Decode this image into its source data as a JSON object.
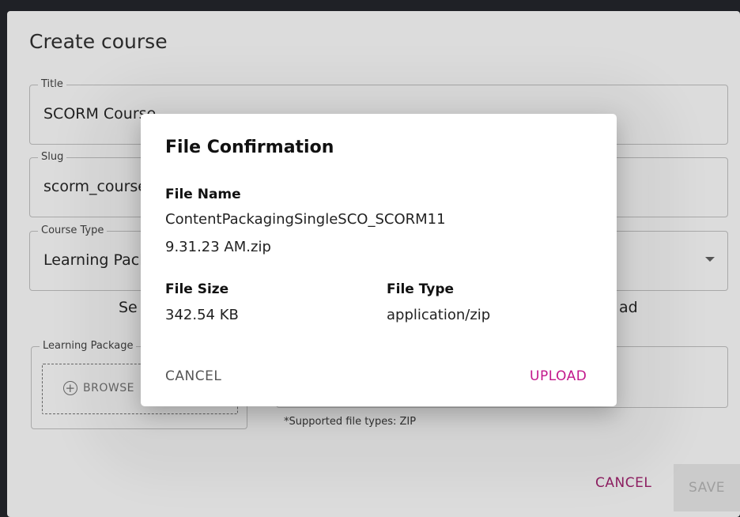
{
  "create_course": {
    "title": "Create course",
    "fields": {
      "title": {
        "label": "Title",
        "value": "SCORM Course"
      },
      "slug": {
        "label": "Slug",
        "value": "scorm_course"
      },
      "course_type": {
        "label": "Course Type",
        "value": "Learning Package"
      }
    },
    "select_text_left": "Se",
    "select_text_right": "ad",
    "learning_package": {
      "label": "Learning Package",
      "browse_label": "BROWSE"
    },
    "supported_note": "*Supported file types: ZIP",
    "actions": {
      "cancel": "CANCEL",
      "save": "SAVE"
    }
  },
  "file_confirmation": {
    "title": "File Confirmation",
    "file_name_label": "File Name",
    "file_name_line1": "ContentPackagingSingleSCO_SCORM11",
    "file_name_line2": "9.31.23 AM.zip",
    "file_size_label": "File Size",
    "file_size_value": "342.54 KB",
    "file_type_label": "File Type",
    "file_type_value": "application/zip",
    "actions": {
      "cancel": "CANCEL",
      "upload": "UPLOAD"
    }
  },
  "colors": {
    "accent": "#c2188b",
    "outer_cancel": "#8e1f62"
  }
}
